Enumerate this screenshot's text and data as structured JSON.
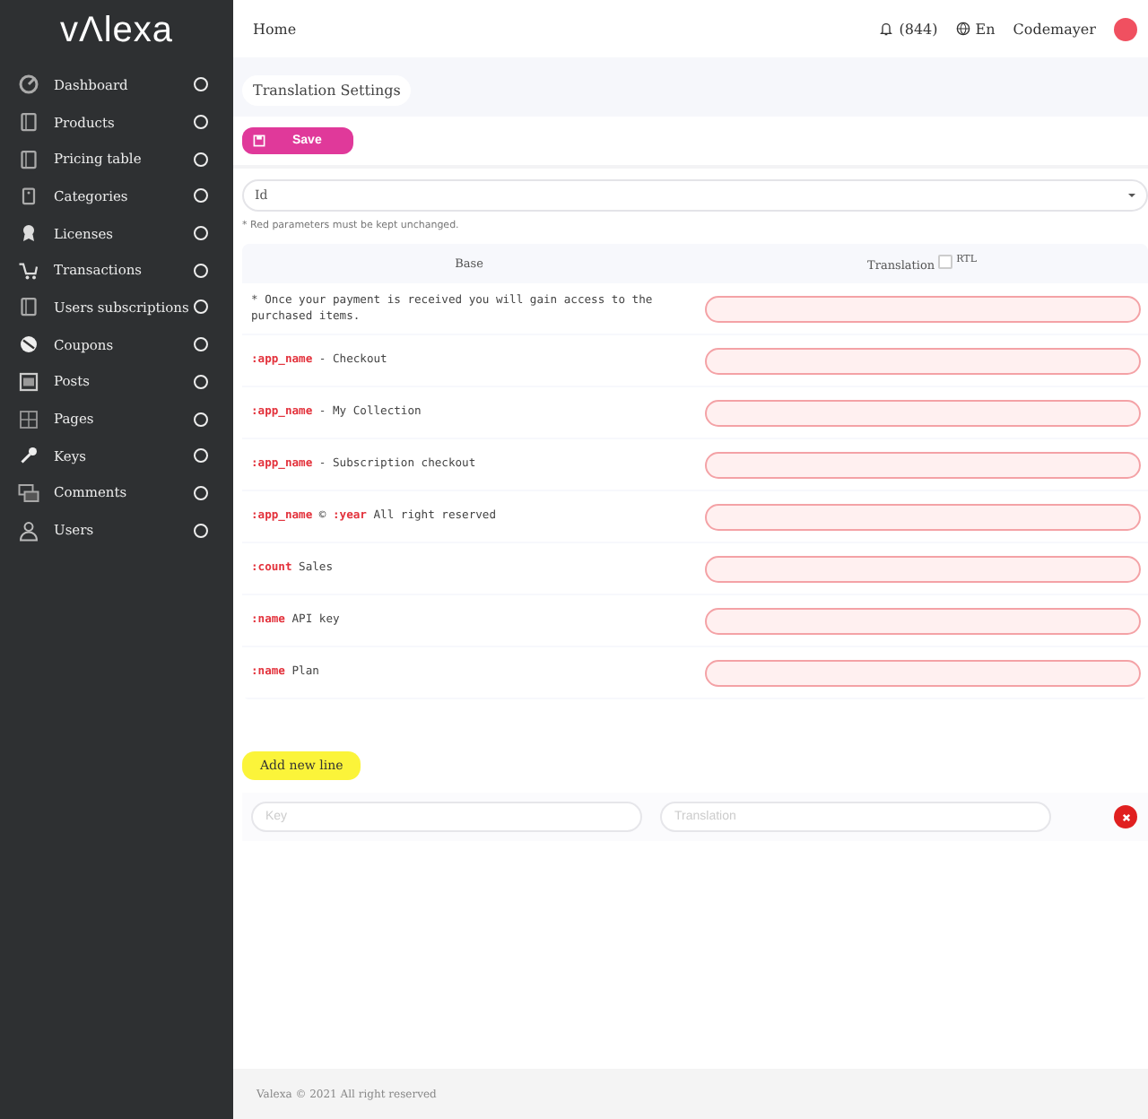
{
  "sidebar": {
    "logo": "vΛlexa",
    "items": [
      {
        "label": "Dashboard"
      },
      {
        "label": "Products"
      },
      {
        "label": "Pricing table"
      },
      {
        "label": "Categories"
      },
      {
        "label": "Licenses"
      },
      {
        "label": "Transactions"
      },
      {
        "label": "Users subscriptions"
      },
      {
        "label": "Coupons"
      },
      {
        "label": "Posts"
      },
      {
        "label": "Pages"
      },
      {
        "label": "Keys"
      },
      {
        "label": "Comments"
      },
      {
        "label": "Users"
      }
    ]
  },
  "topbar": {
    "breadcrumb": "Home",
    "notifications": "(844)",
    "language": "En",
    "username": "Codemayer"
  },
  "page_title": "Translation Settings",
  "save_button": "Save",
  "language_select": {
    "value": "Id"
  },
  "note": "* Red parameters must be kept unchanged.",
  "table": {
    "columns": [
      "Base",
      "Translation"
    ],
    "rtl": {
      "label": "RTL",
      "checked": false
    },
    "rows": [
      {
        "base": [
          {
            "kind": "text",
            "text": "* Once your payment is received you will gain access to the purchased items."
          }
        ]
      },
      {
        "base": [
          {
            "kind": "param",
            "text": ":app_name"
          },
          {
            "kind": "text",
            "text": " - Checkout"
          }
        ]
      },
      {
        "base": [
          {
            "kind": "param",
            "text": ":app_name"
          },
          {
            "kind": "text",
            "text": " - My Collection"
          }
        ]
      },
      {
        "base": [
          {
            "kind": "param",
            "text": ":app_name"
          },
          {
            "kind": "text",
            "text": " - Subscription checkout"
          }
        ]
      },
      {
        "base": [
          {
            "kind": "param",
            "text": ":app_name"
          },
          {
            "kind": "text",
            "text": " © "
          },
          {
            "kind": "param",
            "text": ":year"
          },
          {
            "kind": "text",
            "text": " All right reserved"
          }
        ]
      },
      {
        "base": [
          {
            "kind": "param",
            "text": ":count"
          },
          {
            "kind": "text",
            "text": " Sales"
          }
        ]
      },
      {
        "base": [
          {
            "kind": "param",
            "text": ":name"
          },
          {
            "kind": "text",
            "text": " API key"
          }
        ]
      },
      {
        "base": [
          {
            "kind": "param",
            "text": ":name"
          },
          {
            "kind": "text",
            "text": " Plan"
          }
        ]
      }
    ]
  },
  "add_button": "Add new line",
  "new_line": {
    "key_placeholder": "Key",
    "translation_placeholder": "Translation"
  },
  "footer": "Valexa © 2021 All right reserved"
}
